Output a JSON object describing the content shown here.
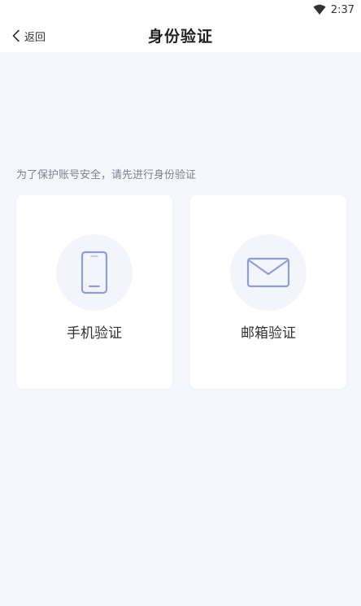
{
  "status": {
    "time": "2:37",
    "wifi_icon": "wifi-icon"
  },
  "nav": {
    "back_label": "返回",
    "title": "身份验证",
    "back_icon": "chevron-left-icon"
  },
  "hint": "为了保护账号安全，请先进行身份验证",
  "options": [
    {
      "label": "手机验证",
      "icon": "phone-icon"
    },
    {
      "label": "邮箱验证",
      "icon": "mail-icon"
    }
  ],
  "colors": {
    "accent": "#8e9fd6",
    "background": "#f5f7fd",
    "card": "#ffffff"
  }
}
